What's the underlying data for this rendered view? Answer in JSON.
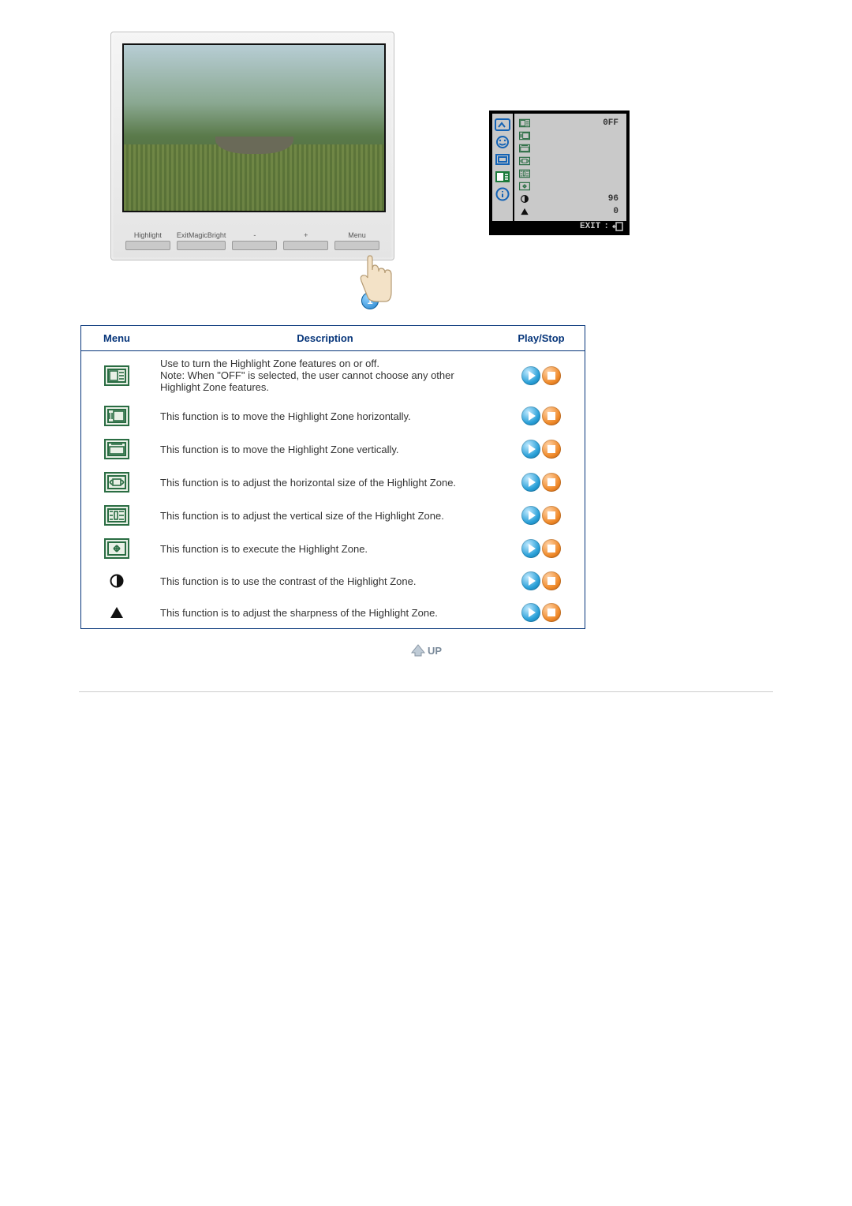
{
  "monitor_buttons": [
    {
      "top": "",
      "bottom": "Highlight"
    },
    {
      "top": "Exit",
      "bottom": "MagicBright"
    },
    {
      "top": "",
      "bottom": "-"
    },
    {
      "top": "",
      "bottom": "+"
    },
    {
      "top": "",
      "bottom": "Menu"
    }
  ],
  "callout_number": "1",
  "osd": {
    "rows": [
      {
        "icon": "hz-toggle",
        "value": "0FF"
      },
      {
        "icon": "h-move",
        "value": ""
      },
      {
        "icon": "v-move",
        "value": ""
      },
      {
        "icon": "h-size",
        "value": ""
      },
      {
        "icon": "v-size",
        "value": ""
      },
      {
        "icon": "execute",
        "value": ""
      },
      {
        "icon": "contrast",
        "value": "96"
      },
      {
        "icon": "sharpness",
        "value": "0"
      }
    ],
    "footer": "EXIT"
  },
  "table": {
    "headers": {
      "menu": "Menu",
      "description": "Description",
      "playstop": "Play/Stop"
    },
    "rows": [
      {
        "icon": "hz-toggle",
        "framed": true,
        "desc": "Use to turn the Highlight Zone features on or off.\nNote: When \"OFF\" is selected, the user cannot choose any other Highlight Zone features."
      },
      {
        "icon": "h-move",
        "framed": true,
        "desc": "This function is to move the Highlight Zone horizontally."
      },
      {
        "icon": "v-move",
        "framed": true,
        "desc": "This function is to move the Highlight Zone vertically."
      },
      {
        "icon": "h-size",
        "framed": true,
        "desc": "This function is to adjust the horizontal size of the Highlight Zone."
      },
      {
        "icon": "v-size",
        "framed": true,
        "desc": "This function is to adjust the vertical size of the Highlight Zone."
      },
      {
        "icon": "execute",
        "framed": true,
        "desc": "This function is to execute the Highlight Zone."
      },
      {
        "icon": "contrast",
        "framed": false,
        "desc": "This function is to use the contrast of the Highlight Zone."
      },
      {
        "icon": "sharpness",
        "framed": false,
        "desc": "This function is to adjust the sharpness of the Highlight Zone."
      }
    ]
  },
  "up_label": "UP"
}
